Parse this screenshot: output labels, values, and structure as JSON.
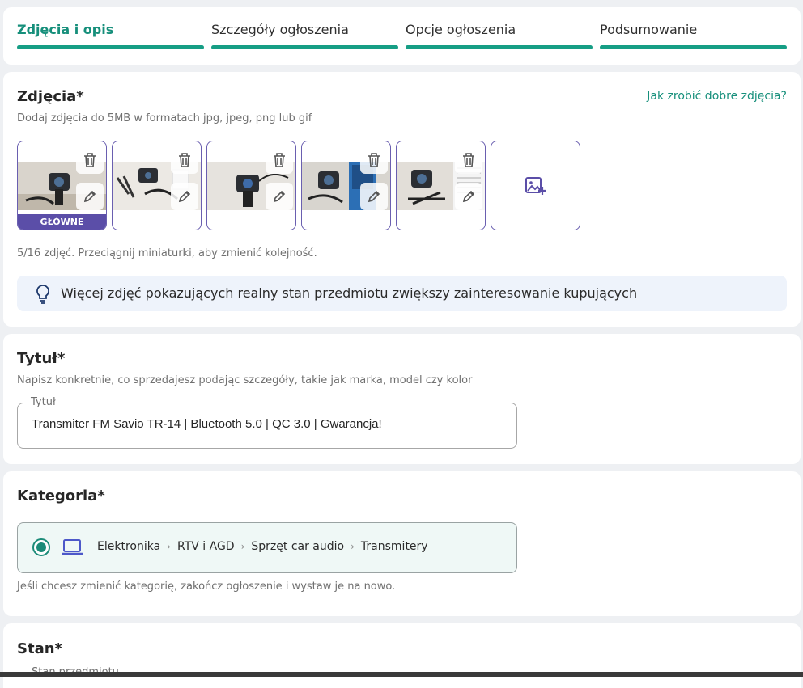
{
  "steps": [
    {
      "label": "Zdjęcia i opis",
      "active": true
    },
    {
      "label": "Szczegóły ogłoszenia",
      "active": false
    },
    {
      "label": "Opcje ogłoszenia",
      "active": false
    },
    {
      "label": "Podsumowanie",
      "active": false
    }
  ],
  "photos": {
    "title": "Zdjęcia*",
    "help_link": "Jak zrobić dobre zdjęcia?",
    "hint": "Dodaj zdjęcia do 5MB w formatach jpg, jpeg, png lub gif",
    "main_badge": "GŁÓWNE",
    "count_text": "5/16 zdjęć. Przeciągnij miniaturki, aby zmienić kolejność.",
    "tip": "Więcej zdjęć pokazujących realny stan przedmiotu zwiększy zainteresowanie kupujących"
  },
  "title_section": {
    "title": "Tytuł*",
    "hint": "Napisz konkretnie, co sprzedajesz podając szczegóły, takie jak marka, model czy kolor",
    "field_label": "Tytuł",
    "value": "Transmiter FM Savio TR-14 | Bluetooth 5.0 | QC 3.0 | Gwarancja!"
  },
  "category": {
    "title": "Kategoria*",
    "path": [
      "Elektronika",
      "RTV i AGD",
      "Sprzęt car audio",
      "Transmitery"
    ],
    "hint": "Jeśli chcesz zmienić kategorię, zakończ ogłoszenie i wystaw je na nowo."
  },
  "condition": {
    "title": "Stan*",
    "field_label": "Stan przedmiotu"
  },
  "colors": {
    "accent": "#168f7b",
    "border_purple": "#6a5fb0",
    "badge": "#5b4ea8"
  }
}
